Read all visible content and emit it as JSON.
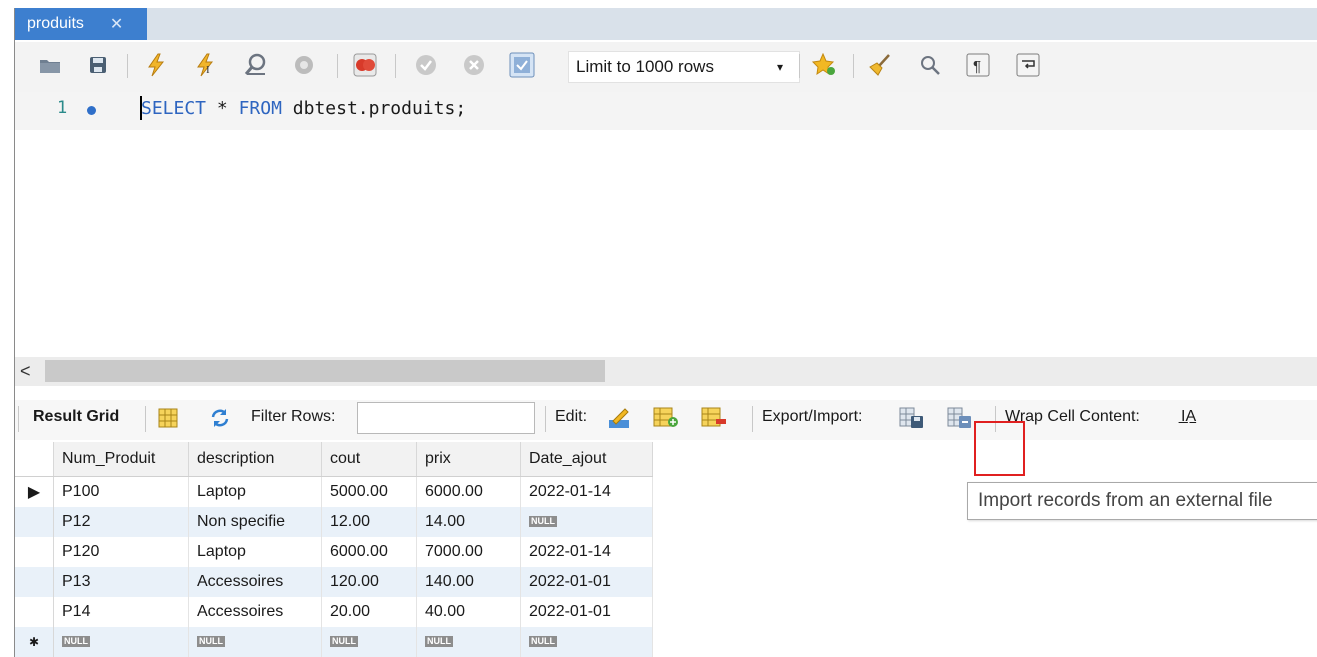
{
  "tab": {
    "label": "produits",
    "close": "✕"
  },
  "toolbar": {
    "limit_select": "Limit to 1000 rows",
    "limit_arrow": "▾"
  },
  "editor": {
    "line_number": "1",
    "keyword_select": "SELECT",
    "star": "*",
    "keyword_from": "FROM",
    "table_ref": "dbtest.produits;"
  },
  "scroll": {
    "left_arrow": "<"
  },
  "results_toolbar": {
    "result_grid": "Result Grid",
    "filter_rows": "Filter Rows:",
    "filter_value": "",
    "edit": "Edit:",
    "export_import": "Export/Import:",
    "wrap_cell": "Wrap Cell Content:",
    "wrap_icon": "I̲A"
  },
  "grid": {
    "columns": [
      "Num_Produit",
      "description",
      "cout",
      "prix",
      "Date_ajout"
    ],
    "rows": [
      [
        "P100",
        "Laptop",
        "5000.00",
        "6000.00",
        "2022-01-14"
      ],
      [
        "P12",
        "Non specifie",
        "12.00",
        "14.00",
        "NULL"
      ],
      [
        "P120",
        "Laptop",
        "6000.00",
        "7000.00",
        "2022-01-14"
      ],
      [
        "P13",
        "Accessoires",
        "120.00",
        "140.00",
        "2022-01-01"
      ],
      [
        "P14",
        "Accessoires",
        "20.00",
        "40.00",
        "2022-01-01"
      ],
      [
        "NULL",
        "NULL",
        "NULL",
        "NULL",
        "NULL"
      ]
    ],
    "current_marker": "▶",
    "new_marker": "✱"
  },
  "tooltip": {
    "text": "Import records from an external file"
  },
  "colors": {
    "tab_active": "#3d7fcf",
    "keyword": "#2e65c0",
    "highlight": "#e02020",
    "row_alt": "#e9f1f9"
  }
}
